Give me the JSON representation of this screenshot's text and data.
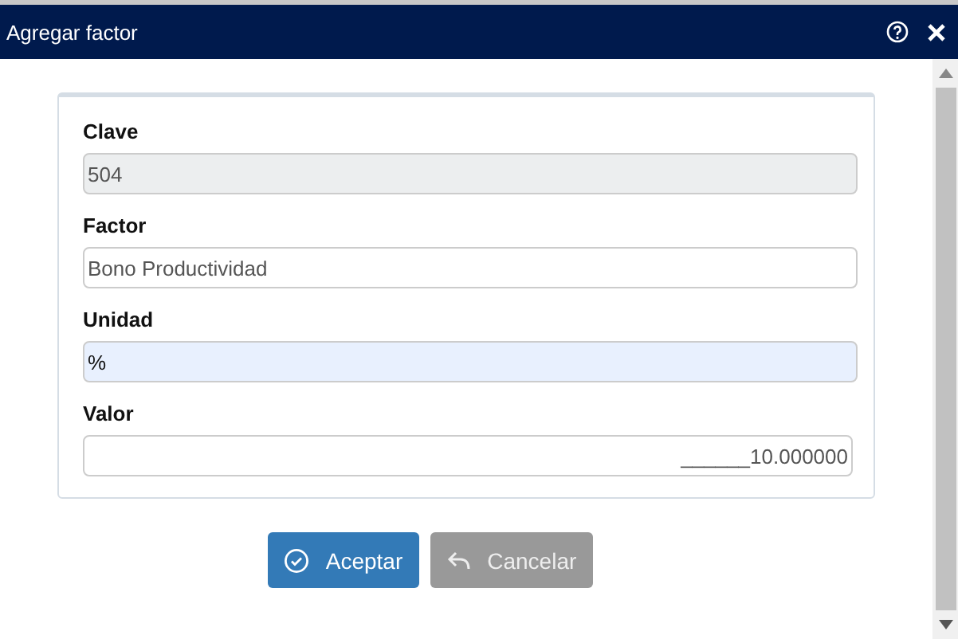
{
  "window": {
    "title": "Agregar factor"
  },
  "fields": [
    {
      "label": "Clave",
      "value": "504",
      "kind": "readonly"
    },
    {
      "label": "Factor",
      "value": "Bono Productividad",
      "kind": "text"
    },
    {
      "label": "Unidad",
      "value": "%",
      "kind": "autofill"
    },
    {
      "label": "Valor",
      "value": "______10.000000",
      "kind": "number"
    }
  ],
  "buttons": [
    {
      "label": "Aceptar",
      "kind": "primary"
    },
    {
      "label": "Cancelar",
      "kind": "secondary",
      "disabled": true
    }
  ]
}
